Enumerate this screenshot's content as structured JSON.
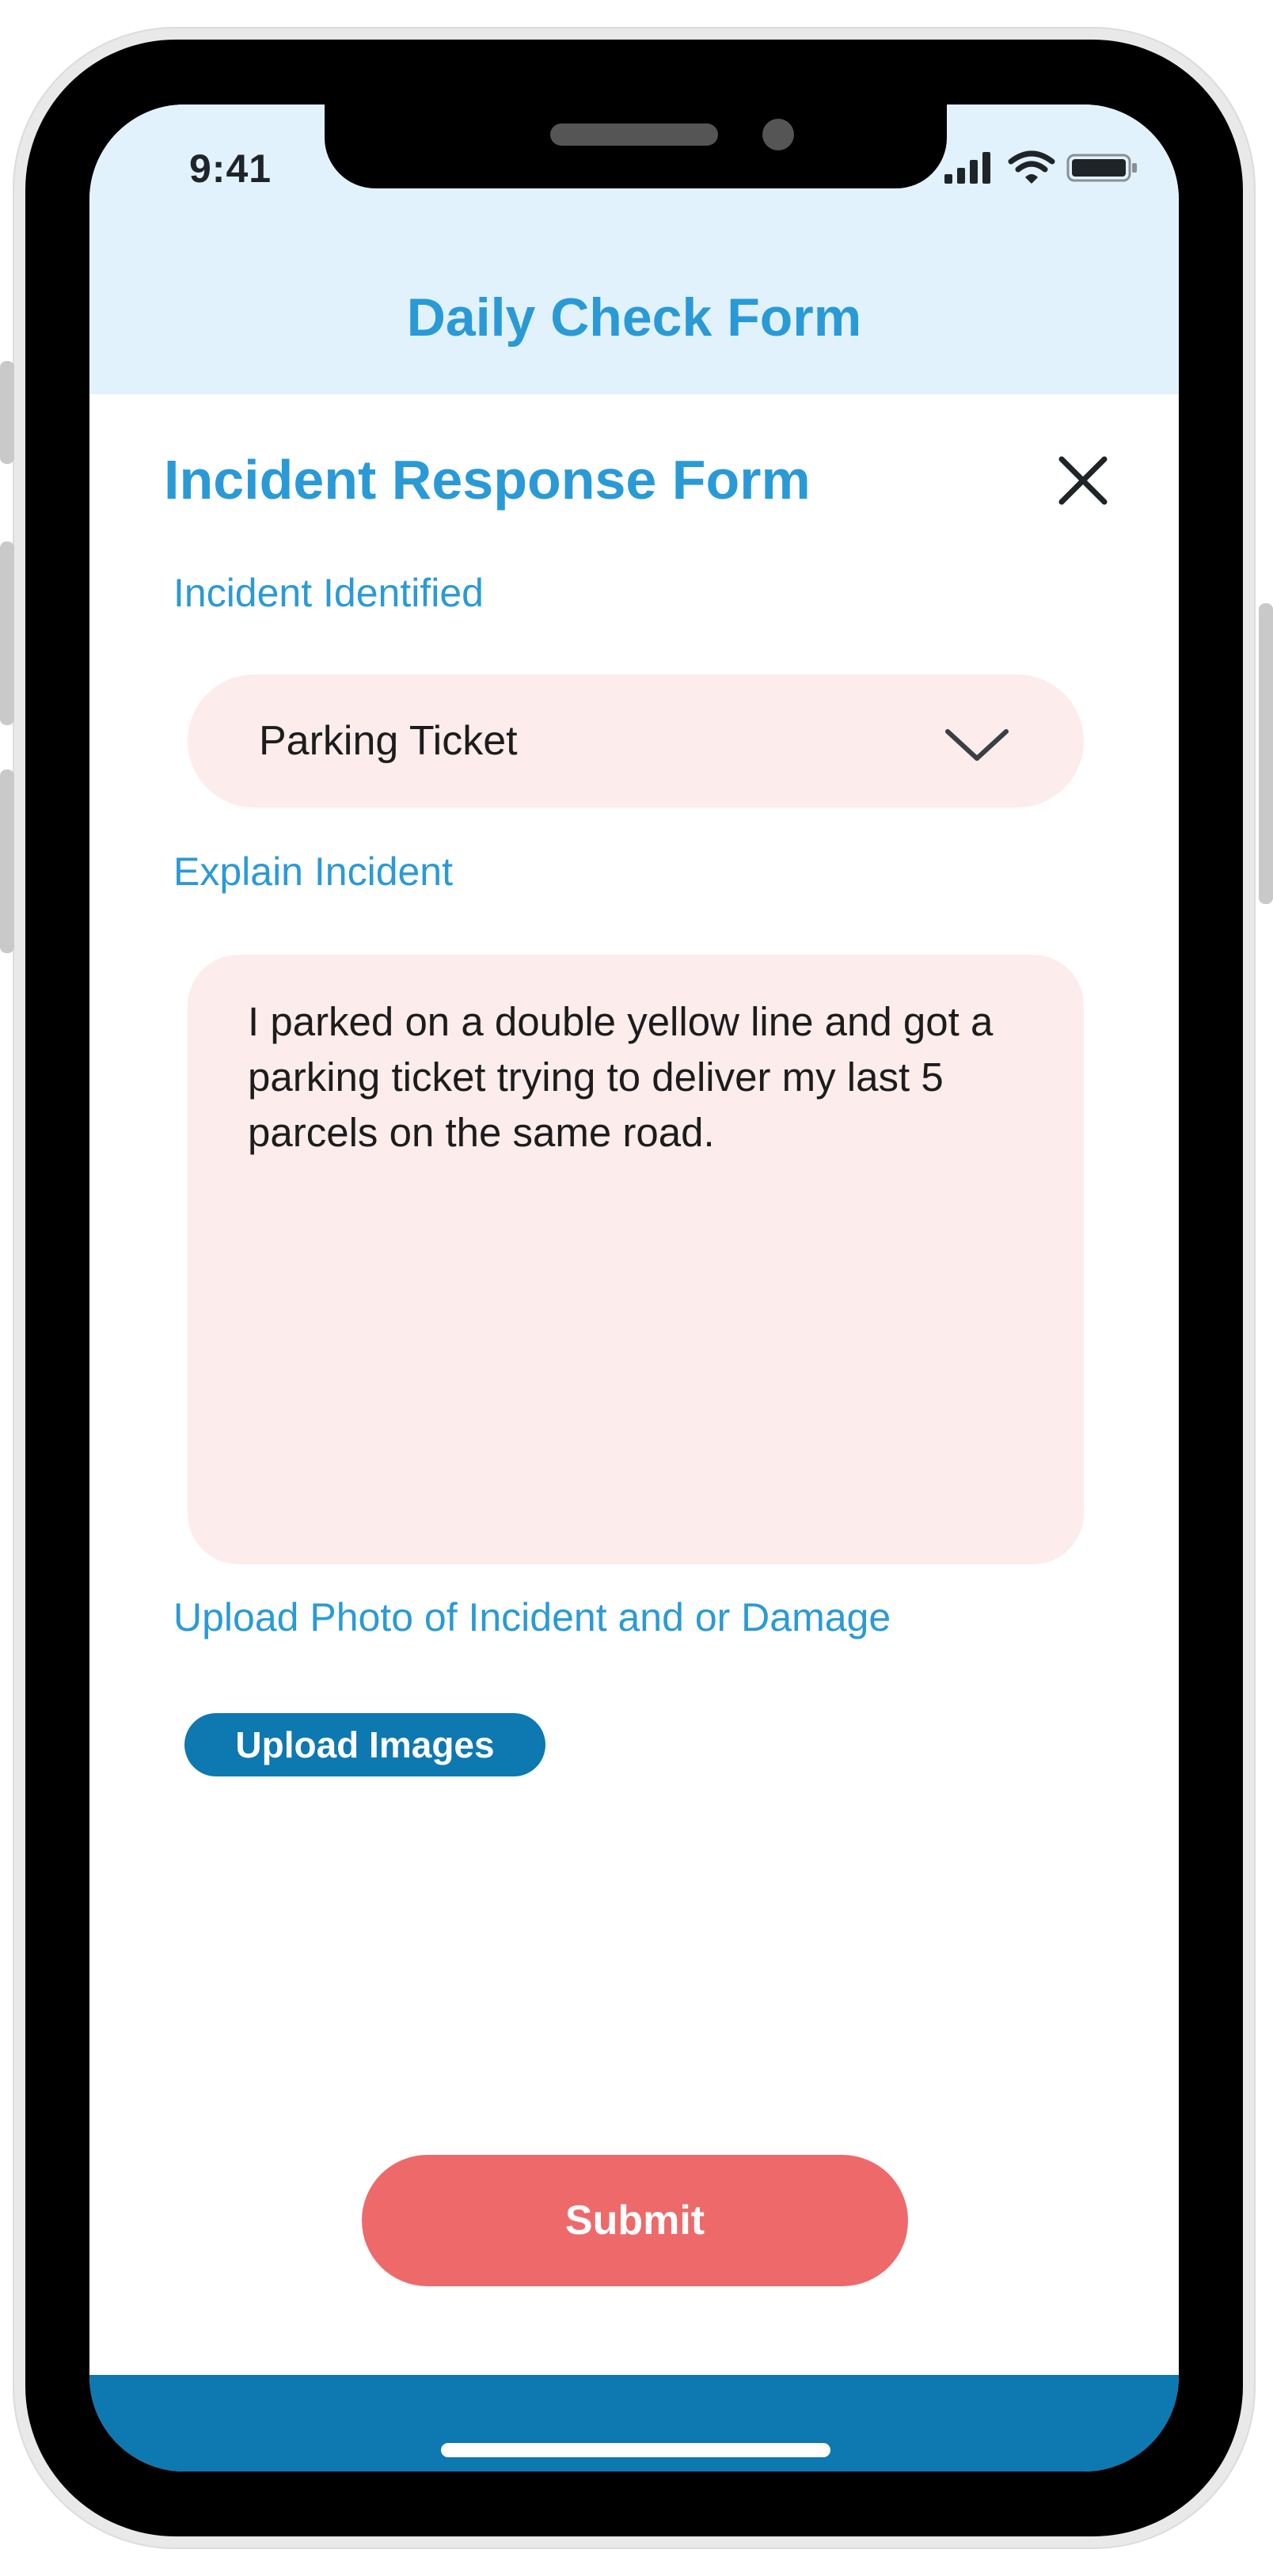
{
  "status_bar": {
    "time": "9:41",
    "icons": [
      "cellular-signal-icon",
      "wifi-icon",
      "battery-icon"
    ]
  },
  "header": {
    "title": "Daily Check Form"
  },
  "form": {
    "title": "Incident Response Form",
    "close_icon": "close-icon",
    "incident_identified": {
      "label": "Incident Identified",
      "selected_value": "Parking Ticket",
      "chevron_icon": "chevron-down-icon"
    },
    "explain_incident": {
      "label": "Explain Incident",
      "value": "I parked on a double yellow line and got a parking ticket trying to deliver my last 5 parcels on the same road."
    },
    "upload": {
      "label": "Upload Photo of Incident and or Damage",
      "button_label": "Upload Images"
    },
    "submit_label": "Submit"
  },
  "colors": {
    "accent_blue": "#2a9ad6",
    "header_bg": "#e1f2fc",
    "field_bg": "#fdecec",
    "primary_button": "#0e78b0",
    "submit_button": "#ee6a6a"
  }
}
